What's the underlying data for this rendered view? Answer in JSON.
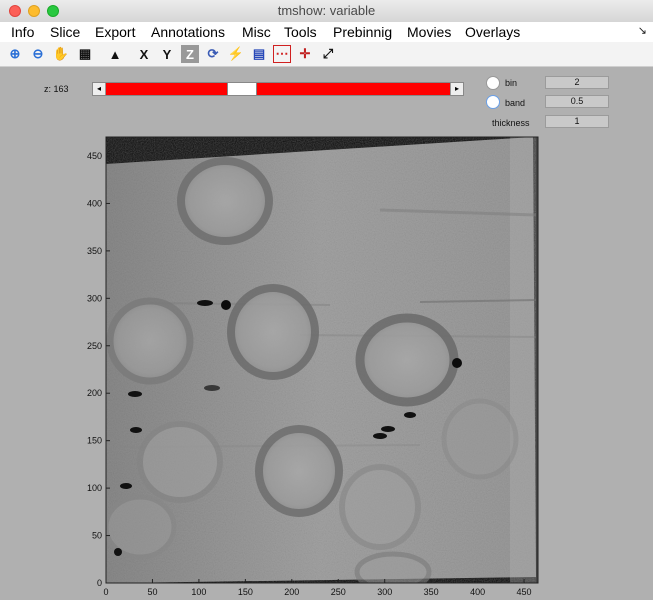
{
  "window": {
    "title": "tmshow: variable"
  },
  "menubar": {
    "items": [
      "Info",
      "Slice",
      "Export",
      "Annotations",
      "Misc",
      "Tools",
      "Prebinnig",
      "Movies",
      "Overlays"
    ],
    "corner": "↘"
  },
  "toolbar": {
    "tools": [
      {
        "name": "zoom-in-icon",
        "glyph": "⊕"
      },
      {
        "name": "zoom-out-icon",
        "glyph": "⊖"
      },
      {
        "name": "pan-hand-icon",
        "glyph": "✋"
      },
      {
        "name": "colormap-icon",
        "glyph": "▦"
      },
      {
        "name": "histogram-icon",
        "glyph": "▲"
      },
      {
        "name": "x-axis-icon",
        "glyph": "X"
      },
      {
        "name": "y-axis-icon",
        "glyph": "Y"
      },
      {
        "name": "z-axis-icon",
        "glyph": "Z"
      },
      {
        "name": "rotate-3d-icon",
        "glyph": "⟳"
      },
      {
        "name": "link-icon",
        "glyph": "⚡"
      },
      {
        "name": "film-icon",
        "glyph": "▤"
      },
      {
        "name": "dots-grid-icon",
        "glyph": "⋯"
      },
      {
        "name": "crosshair-grid-icon",
        "glyph": "✛"
      },
      {
        "name": "fullscreen-icon",
        "glyph": "⤢"
      }
    ]
  },
  "controls": {
    "z_label": "z: 163",
    "slider": {
      "position_fraction": 0.39
    },
    "bin_label": "bin",
    "bin_value": "2",
    "band_label": "band",
    "band_value": "0.5",
    "thickness_label": "thickness",
    "thickness_value": "1"
  },
  "plot": {
    "x_ticks": [
      "0",
      "50",
      "100",
      "150",
      "200",
      "250",
      "300",
      "350",
      "400",
      "450"
    ],
    "y_ticks": [
      "0",
      "50",
      "100",
      "150",
      "200",
      "250",
      "300",
      "350",
      "400",
      "450"
    ],
    "x_range": [
      0,
      465
    ],
    "y_range": [
      0,
      470
    ]
  },
  "colors": {
    "slider_track": "#ff0000",
    "field_bg": "#c9c9c9"
  }
}
